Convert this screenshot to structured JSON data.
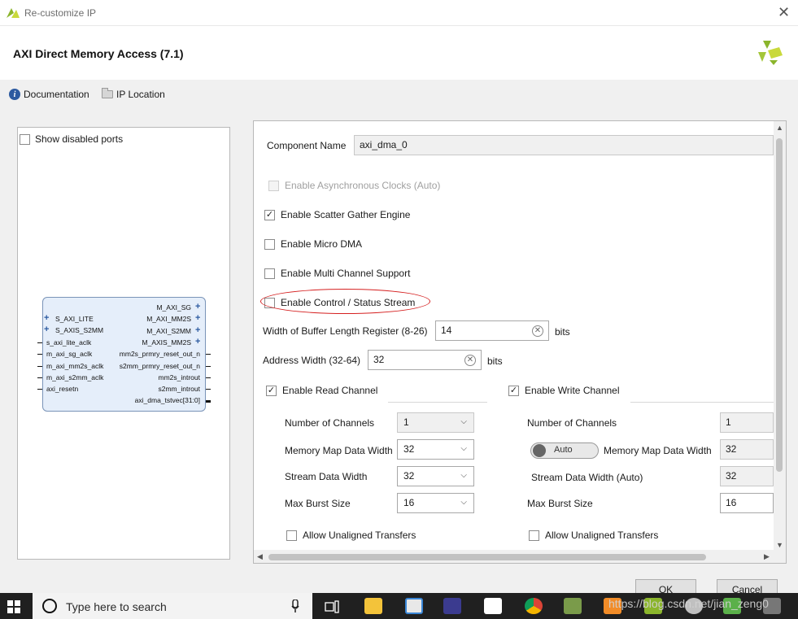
{
  "window": {
    "title": "Re-customize IP",
    "close_glyph": "✕"
  },
  "header": {
    "ip_name": "AXI Direct Memory Access (7.1)",
    "documentation_label": "Documentation",
    "ip_location_label": "IP Location"
  },
  "left_panel": {
    "show_disabled_ports_label": "Show disabled ports",
    "block": {
      "left_ports": [
        "S_AXI_LITE",
        "S_AXIS_S2MM",
        "s_axi_lite_aclk",
        "m_axi_sg_aclk",
        "m_axi_mm2s_aclk",
        "m_axi_s2mm_aclk",
        "axi_resetn"
      ],
      "right_ports": [
        "M_AXI_SG",
        "M_AXI_MM2S",
        "M_AXI_S2MM",
        "M_AXIS_MM2S",
        "mm2s_prmry_reset_out_n",
        "s2mm_prmry_reset_out_n",
        "mm2s_introut",
        "s2mm_introut",
        "axi_dma_tstvec[31:0]"
      ]
    }
  },
  "config": {
    "component_name_label": "Component Name",
    "component_name_value": "axi_dma_0",
    "enable_async_clocks_label": "Enable Asynchronous Clocks (Auto)",
    "enable_scatter_gather_label": "Enable Scatter Gather Engine",
    "enable_scatter_gather_checked": true,
    "enable_micro_dma_label": "Enable Micro DMA",
    "enable_multi_channel_label": "Enable Multi Channel Support",
    "enable_control_status_label": "Enable Control / Status Stream",
    "buffer_length_label": "Width of Buffer Length Register (8-26)",
    "buffer_length_value": "14",
    "buffer_length_unit": "bits",
    "address_width_label": "Address Width (32-64)",
    "address_width_value": "32",
    "address_width_unit": "bits",
    "checkmark": "✓",
    "chevron": "⌵"
  },
  "read_channel": {
    "label": "Enable Read Channel",
    "checked": true,
    "num_channels_label": "Number of Channels",
    "num_channels_value": "1",
    "mm_data_width_label": "Memory Map Data Width",
    "mm_data_width_value": "32",
    "stream_data_width_label": "Stream Data Width",
    "stream_data_width_value": "32",
    "max_burst_label": "Max Burst Size",
    "max_burst_value": "16",
    "unaligned_label": "Allow Unaligned Transfers"
  },
  "write_channel": {
    "label": "Enable Write Channel",
    "checked": true,
    "num_channels_label": "Number of Channels",
    "num_channels_value": "1",
    "auto_toggle_label": "Auto",
    "mm_data_width_label": "Memory Map Data Width",
    "mm_data_width_value": "32",
    "stream_data_width_label": "Stream Data Width (Auto)",
    "stream_data_width_value": "32",
    "max_burst_label": "Max Burst Size",
    "max_burst_value": "16",
    "unaligned_label": "Allow Unaligned Transfers"
  },
  "footer": {
    "ok_label": "OK",
    "cancel_label": "Cancel"
  },
  "taskbar": {
    "search_placeholder": "Type here to search",
    "watermark": "https://blog.csdn.net/jian_zeng0"
  },
  "colors": {
    "accent": "#2c5aa0",
    "highlight_ellipse": "#d52020",
    "xilinx_green": "#8bb52c"
  }
}
